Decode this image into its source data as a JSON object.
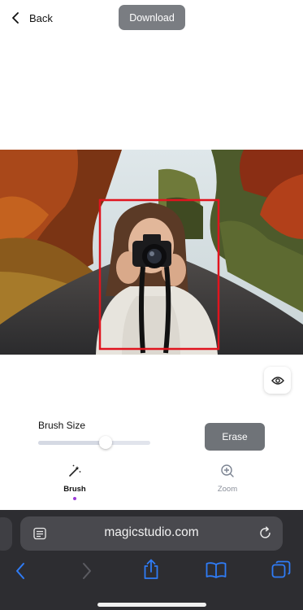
{
  "header": {
    "back_label": "Back",
    "download_label": "Download"
  },
  "editor": {
    "brush_size_label": "Brush Size",
    "brush_size_value": 0.6,
    "erase_label": "Erase",
    "selection_color": "#e0141e"
  },
  "tools": [
    {
      "label": "Brush",
      "icon": "magic-wand-icon",
      "active": true
    },
    {
      "label": "Zoom",
      "icon": "zoom-in-icon",
      "active": false
    }
  ],
  "browser": {
    "url": "magicstudio.com",
    "accent": "#2f7cf6"
  }
}
